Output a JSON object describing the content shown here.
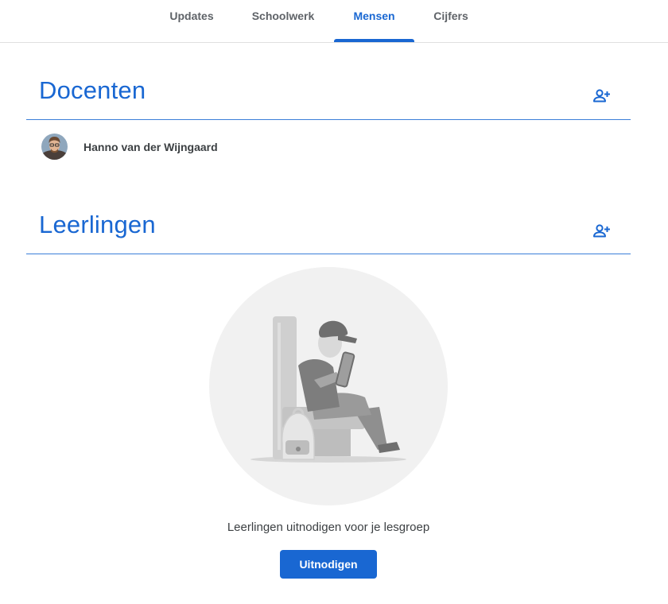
{
  "tabs": [
    {
      "label": "Updates",
      "active": false
    },
    {
      "label": "Schoolwerk",
      "active": false
    },
    {
      "label": "Mensen",
      "active": true
    },
    {
      "label": "Cijfers",
      "active": false
    }
  ],
  "teachers": {
    "title": "Docenten",
    "add_icon": "person-add-icon",
    "members": [
      {
        "name": "Hanno van der Wijngaard",
        "avatar": "avatar-photo"
      }
    ]
  },
  "students": {
    "title": "Leerlingen",
    "add_icon": "person-add-icon",
    "empty_state": {
      "illustration": "student-reading-tablet-illustration",
      "message": "Leerlingen uitnodigen voor je lesgroep",
      "invite_label": "Uitnodigen"
    }
  },
  "colors": {
    "accent": "#1967d2",
    "text": "#3c4043",
    "muted": "#5f6368"
  }
}
